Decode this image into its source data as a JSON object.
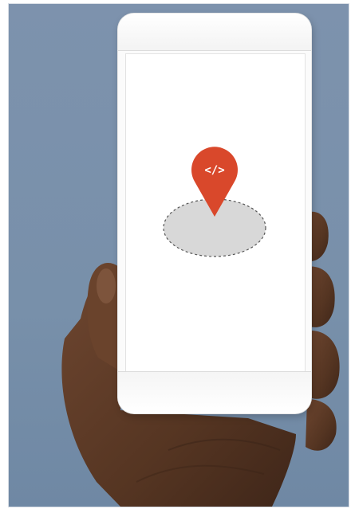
{
  "scene": {
    "marker_glyph": "</>",
    "colors": {
      "background_blue": "#7a8fab",
      "pin_red": "#d9482b",
      "area_gray": "#d8d8d8",
      "skin": "#5b3a24"
    },
    "icons": [
      "location-pin-icon",
      "code-brackets-icon"
    ]
  }
}
